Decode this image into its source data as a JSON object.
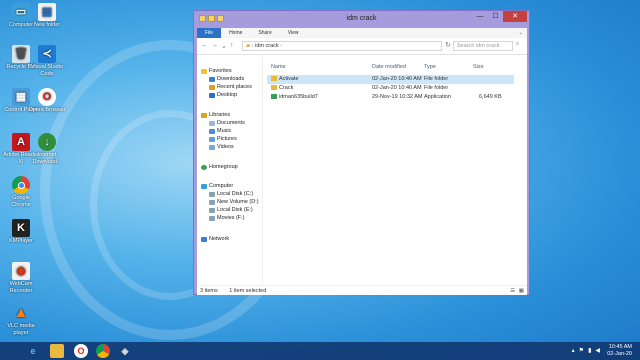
{
  "desktop": {
    "icons": [
      {
        "label": "Computer"
      },
      {
        "label": "New folder"
      },
      {
        "label": "Recycle Bin"
      },
      {
        "label": "Visual Studio Code"
      },
      {
        "label": "Control Panel"
      },
      {
        "label": "Opera Browser"
      },
      {
        "label": "Adobe Reader XI"
      },
      {
        "label": "Internet Download..."
      },
      {
        "label": "Google Chrome"
      },
      {
        "label": "KMPlayer"
      },
      {
        "label": "WebCam Recorder"
      },
      {
        "label": "VLC media player"
      }
    ]
  },
  "window": {
    "title": "idm crack",
    "min": "—",
    "max": "☐",
    "close": "✕",
    "ribbon_tabs": [
      "File",
      "Home",
      "Share",
      "View"
    ],
    "path": "idm crack",
    "search_placeholder": "Search idm crack",
    "nav_pane": {
      "favorites": "Favorites",
      "downloads": "Downloads",
      "recent": "Recent places",
      "desktop": "Desktop",
      "libraries": "Libraries",
      "documents": "Documents",
      "music": "Music",
      "pictures": "Pictures",
      "videos": "Videos",
      "homegroup": "Homegroup",
      "computer": "Computer",
      "local_c": "Local Disk (C:)",
      "new_volume_d": "New Volume (D:)",
      "local_e": "Local Disk (E:)",
      "movies_f": "Movies (F:)",
      "network": "Network"
    },
    "columns": [
      "Name",
      "Date modified",
      "Type",
      "Size"
    ],
    "files": [
      {
        "name": "Activate",
        "date": "02-Jan-20 10:40 AM",
        "type": "File folder",
        "size": ""
      },
      {
        "name": "Crack",
        "date": "02-Jan-20 10:40 AM",
        "type": "File folder",
        "size": ""
      },
      {
        "name": "idman635build7",
        "date": "29-Nov-19 10:32 AM",
        "type": "Application",
        "size": "6,649 KB"
      }
    ],
    "status_items": "3 items",
    "status_selected": "1 item selected"
  },
  "taskbar": {
    "time": "10:45 AM",
    "date": "02-Jan-20"
  }
}
